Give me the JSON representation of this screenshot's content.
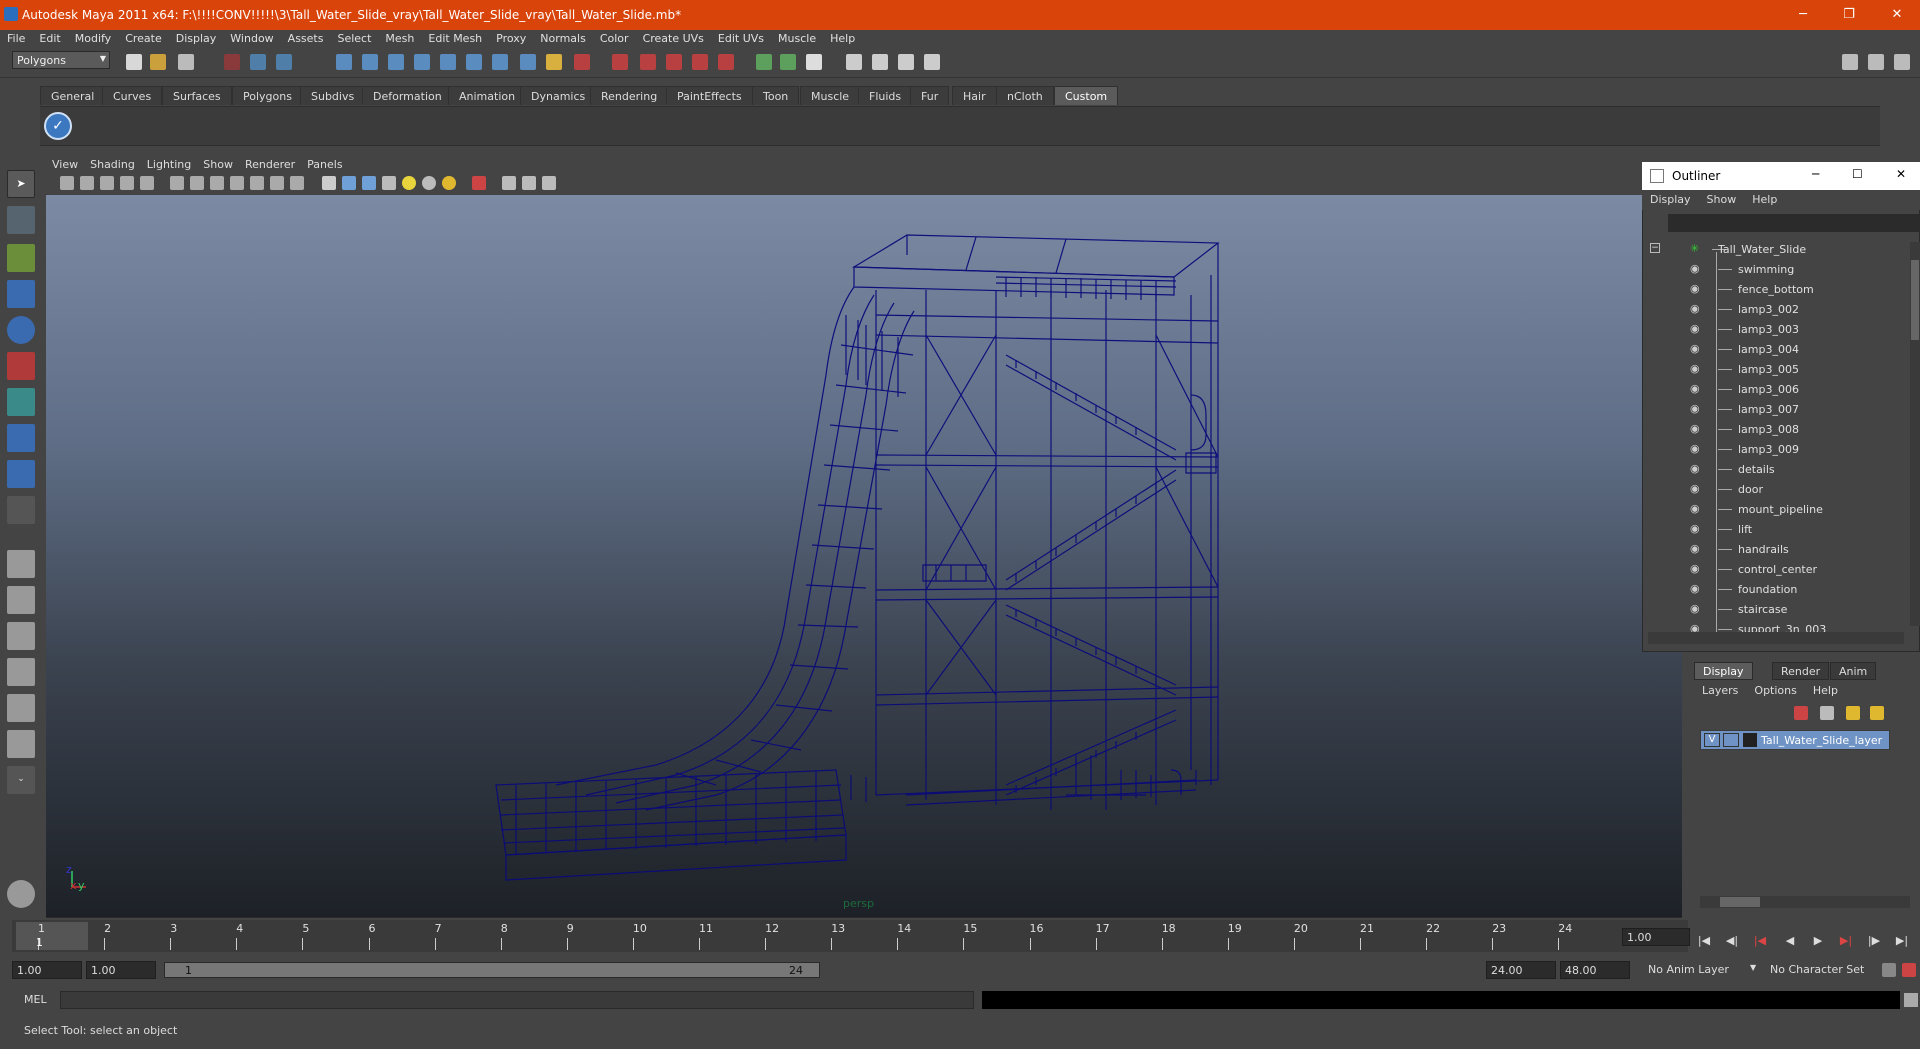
{
  "window": {
    "title": "Autodesk Maya 2011 x64: F:\\!!!!CONV!!!!!\\3\\Tall_Water_Slide_vray\\Tall_Water_Slide_vray\\Tall_Water_Slide.mb*",
    "minimize": "─",
    "restore": "❐",
    "close": "✕"
  },
  "menubar": [
    "File",
    "Edit",
    "Modify",
    "Create",
    "Display",
    "Window",
    "Assets",
    "Select",
    "Mesh",
    "Edit Mesh",
    "Proxy",
    "Normals",
    "Color",
    "Create UVs",
    "Edit UVs",
    "Muscle",
    "Help"
  ],
  "statusline": {
    "mode": "Polygons"
  },
  "shelf_tabs": [
    "General",
    "Curves",
    "Surfaces",
    "Polygons",
    "Subdivs",
    "Deformation",
    "Animation",
    "Dynamics",
    "Rendering",
    "PaintEffects",
    "Toon",
    "Muscle",
    "Fluids",
    "Fur",
    "Hair",
    "nCloth",
    "Custom"
  ],
  "viewport": {
    "menu": [
      "View",
      "Shading",
      "Lighting",
      "Show",
      "Renderer",
      "Panels"
    ],
    "camera_label": "persp",
    "axis_x": "x",
    "axis_y": "y",
    "axis_z": "z",
    "wire_color": "#0a0a7a"
  },
  "outliner": {
    "title": "Outliner",
    "menu": [
      "Display",
      "Show",
      "Help"
    ],
    "items": [
      {
        "label": "Tall_Water_Slide",
        "root": true
      },
      {
        "label": "swimming"
      },
      {
        "label": "fence_bottom"
      },
      {
        "label": "lamp3_002"
      },
      {
        "label": "lamp3_003"
      },
      {
        "label": "lamp3_004"
      },
      {
        "label": "lamp3_005"
      },
      {
        "label": "lamp3_006"
      },
      {
        "label": "lamp3_007"
      },
      {
        "label": "lamp3_008"
      },
      {
        "label": "lamp3_009"
      },
      {
        "label": "details"
      },
      {
        "label": "door"
      },
      {
        "label": "mount_pipeline"
      },
      {
        "label": "lift"
      },
      {
        "label": "handrails"
      },
      {
        "label": "control_center"
      },
      {
        "label": "foundation"
      },
      {
        "label": "staircase"
      },
      {
        "label": "support_3n_003"
      }
    ]
  },
  "layers": {
    "tabs": [
      "Display",
      "Render",
      "Anim"
    ],
    "active_tab": "Display",
    "menu": [
      "Layers",
      "Options",
      "Help"
    ],
    "rows": [
      {
        "visible": "V",
        "name": "Tall_Water_Slide_layer"
      }
    ]
  },
  "timeline": {
    "ticks": [
      "1",
      "2",
      "3",
      "4",
      "5",
      "6",
      "7",
      "8",
      "9",
      "10",
      "11",
      "12",
      "13",
      "14",
      "15",
      "16",
      "17",
      "18",
      "19",
      "20",
      "21",
      "22",
      "23",
      "24"
    ],
    "current_frame_marker": "1",
    "current_time": "1.00"
  },
  "range": {
    "start_time": "1.00",
    "playback_start": "1.00",
    "range_start_label": "1",
    "range_end_label": "24",
    "playback_end": "24.00",
    "end_time": "48.00",
    "anim_layer": "No Anim Layer",
    "character_set": "No Character Set"
  },
  "cmdline": {
    "label": "MEL"
  },
  "helpline": {
    "text": "Select Tool: select an object"
  }
}
